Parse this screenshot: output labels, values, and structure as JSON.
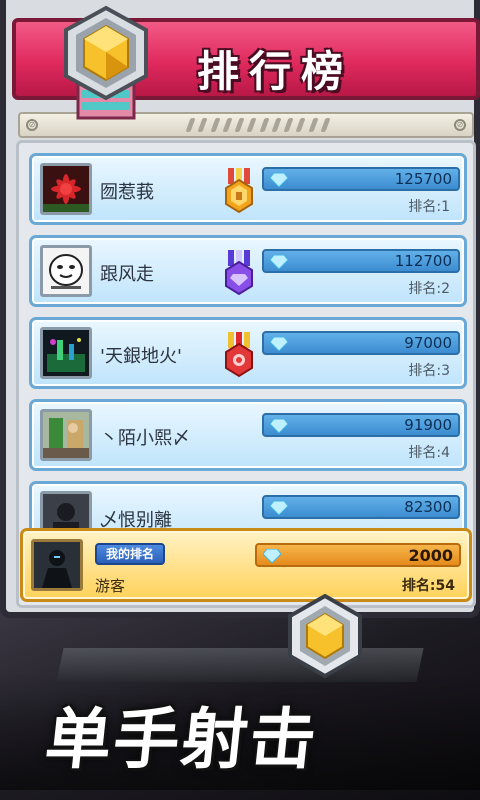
{
  "header": {
    "title": "排行榜"
  },
  "leaderboard": [
    {
      "name": "囫惹莪",
      "score": "125700",
      "rank": "排名:1",
      "medal": "gold"
    },
    {
      "name": "跟风走",
      "score": "112700",
      "rank": "排名:2",
      "medal": "purple"
    },
    {
      "name": "'天銀地火'",
      "score": "97000",
      "rank": "排名:3",
      "medal": "red"
    },
    {
      "name": "丶陌小熙〆",
      "score": "91900",
      "rank": "排名:4",
      "medal": ""
    },
    {
      "name": "乄恨别離",
      "score": "82300",
      "rank": "",
      "medal": ""
    }
  ],
  "my_entry": {
    "tag": "我的排名",
    "name": "游客",
    "score": "2000",
    "rank": "排名:54"
  },
  "slogan": "单手射击",
  "colors": {
    "banner": "#e02a5e",
    "row": "#bfe4fb",
    "my_row": "#ffd25a",
    "score_bar": "#3c8cd1"
  }
}
